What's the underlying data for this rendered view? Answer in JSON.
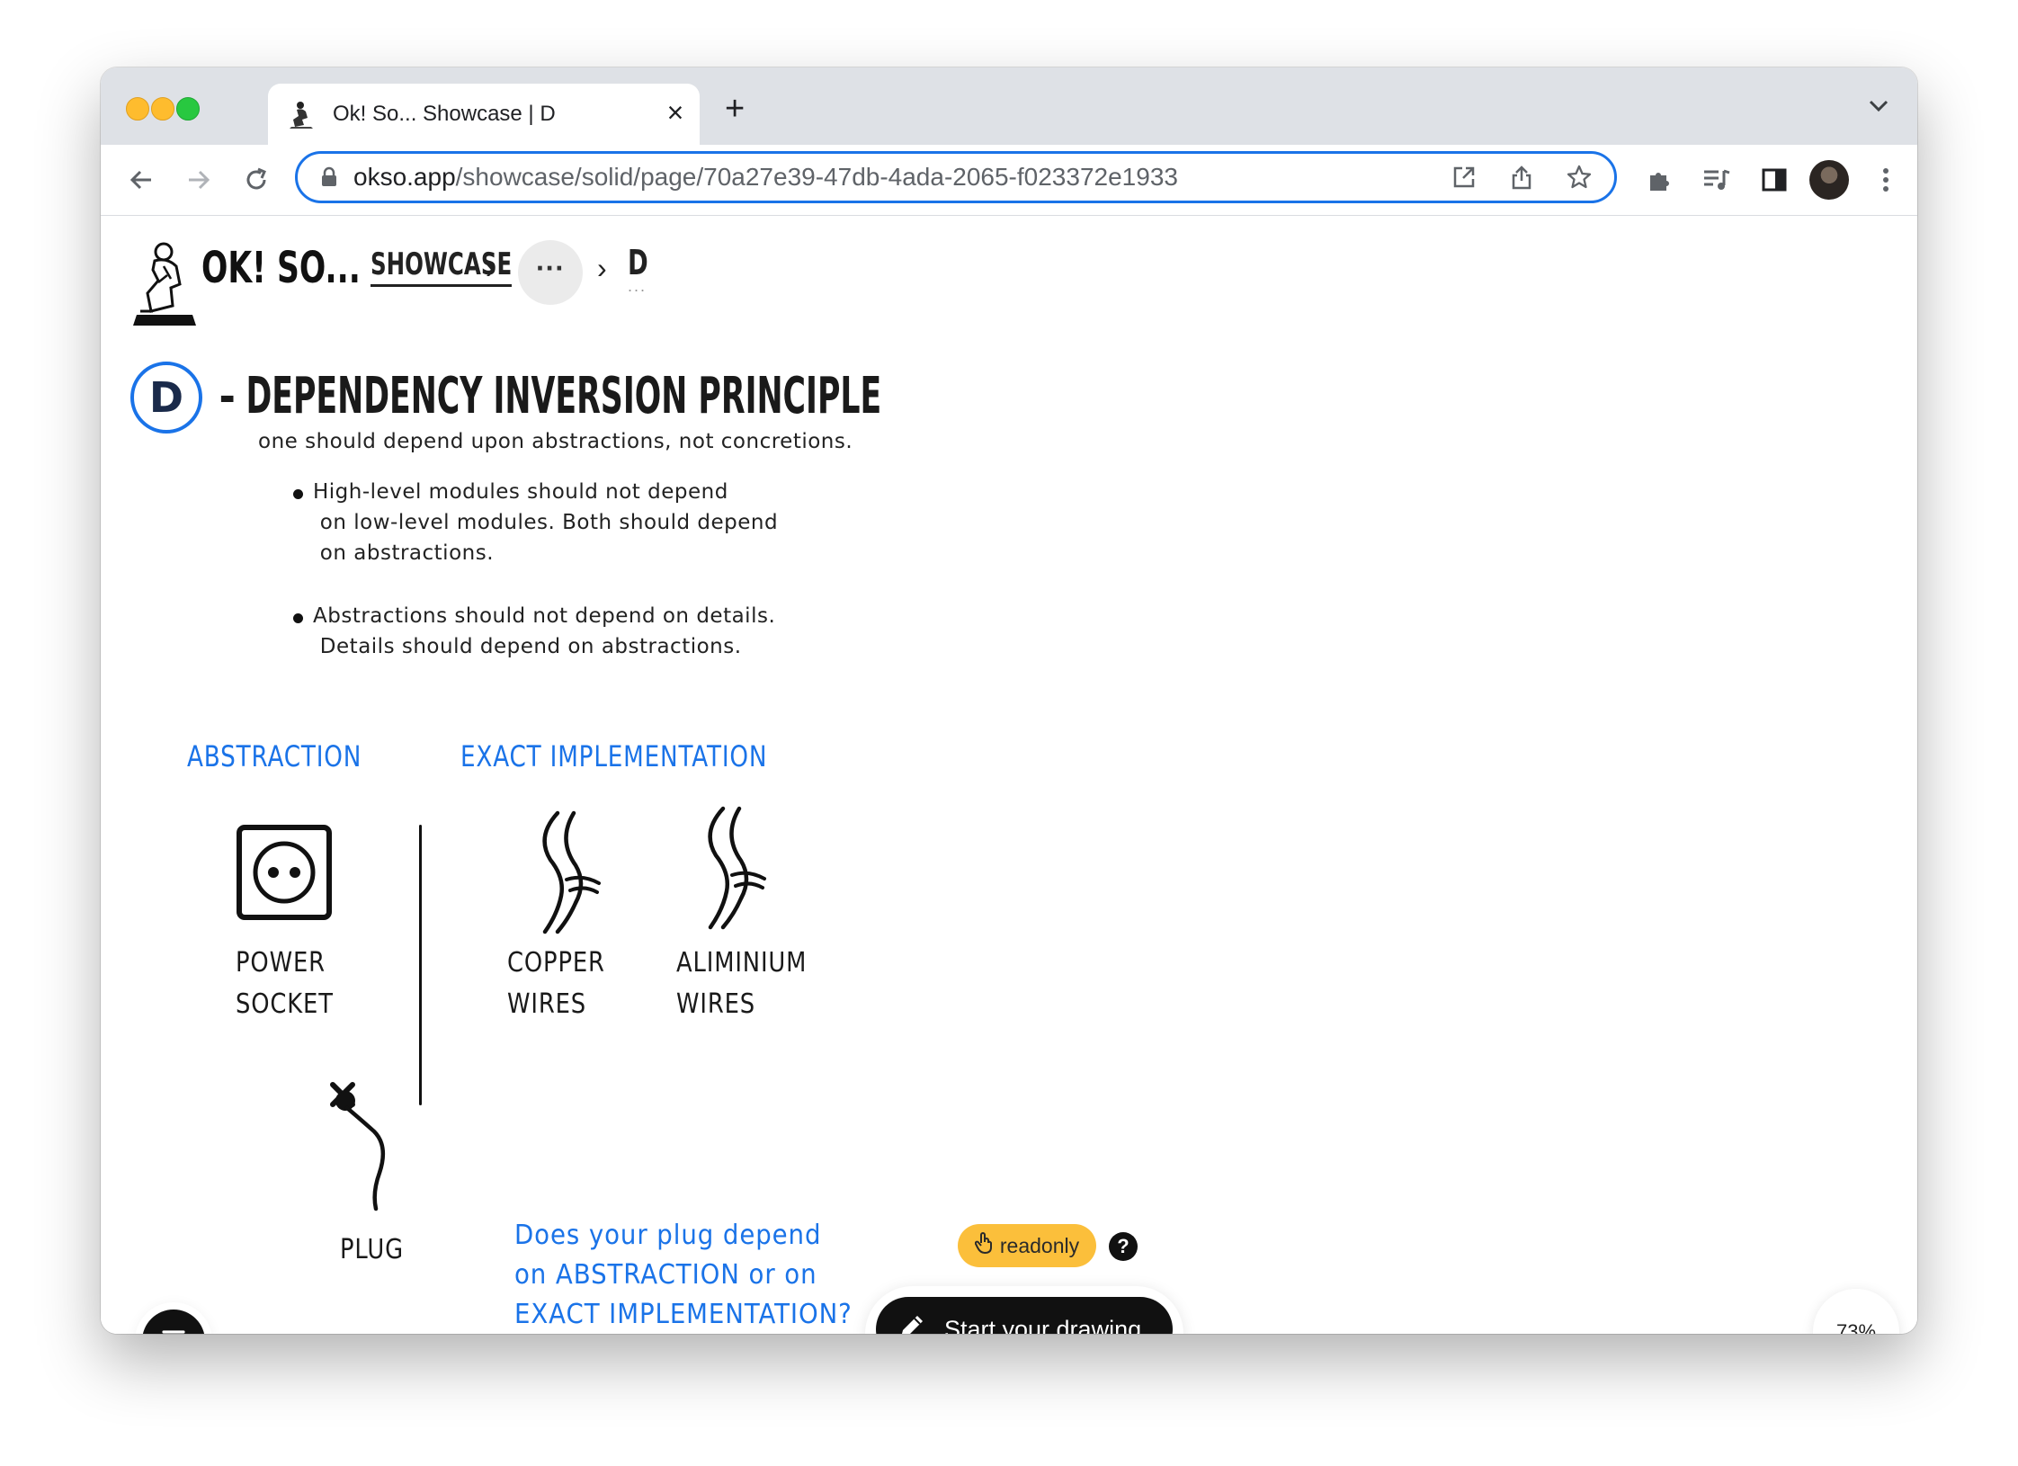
{
  "browser": {
    "tab_title": "Ok! So... Showcase | D",
    "url_host": "okso.app",
    "url_path": "/showcase/solid/page/70a27e39-47db-4ada-2065-f023372e1933",
    "colors": {
      "close": "#ff5f57",
      "minimize": "#febc2e",
      "zoom": "#28c840",
      "focus_ring": "#1a73e8"
    }
  },
  "app": {
    "logo_text": "OK! SO...",
    "breadcrumb": {
      "showcase": "SHOWCASE",
      "more": "···",
      "current": "D",
      "current_hint": "..."
    }
  },
  "principle": {
    "letter": "D",
    "title": "– DEPENDENCY INVERSION PRINCIPLE",
    "subtitle": "one should depend upon abstractions, not concretions.",
    "bullets": [
      "High-level modules should not depend\n on low-level modules. Both should depend\n on abstractions.",
      "Abstractions should not depend on details.\n Details should depend on abstractions."
    ]
  },
  "diagram": {
    "abstraction_label": "ABSTRACTION",
    "implementation_label": "EXACT IMPLEMENTATION",
    "power_socket": "POWER\nSOCKET",
    "copper_wires": "COPPER\nWIRES",
    "aluminium_wires": "ALIMINIUM\nWIRES",
    "plug": "PLUG",
    "question": "Does your plug depend\non ABSTRACTION or on\nEXACT IMPLEMENTATION?",
    "accent_color": "#1a73e8"
  },
  "controls": {
    "readonly_label": "readonly",
    "help_label": "?",
    "cta_label": "Start your drawing",
    "zoom_label": "73%",
    "badge_color": "#fbbf3b"
  }
}
